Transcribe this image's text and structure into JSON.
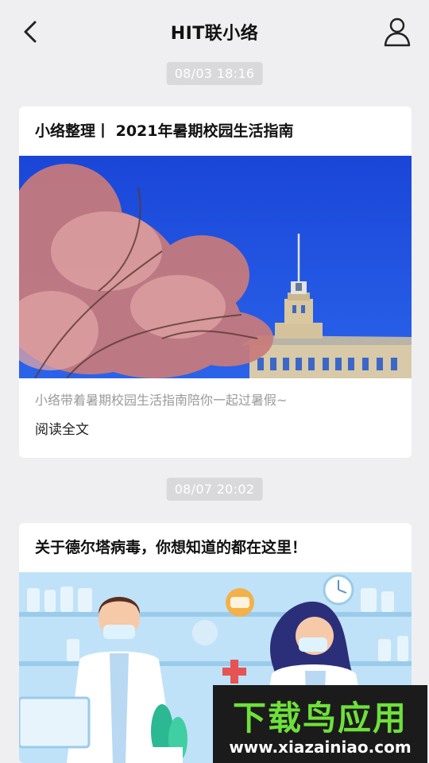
{
  "header": {
    "title": "HIT联小络"
  },
  "messages": [
    {
      "time": "08/03 18:16",
      "title": "小络整理丨 2021年暑期校园生活指南",
      "desc": "小络带着暑期校园生活指南陪你一起过暑假~",
      "read_more": "阅读全文",
      "image": "campus-building-with-blossoms"
    },
    {
      "time": "08/07 20:02",
      "title": "关于德尔塔病毒，你想知道的都在这里！",
      "image": "doctors-illustration"
    }
  ],
  "watermark": {
    "main": "下载鸟应用",
    "url": "www.xiazainiao.com"
  },
  "colors": {
    "background": "#efeff1",
    "sky": "#1f4fdc",
    "blossom": "#d98a8a",
    "accent_green": "#6fe03b"
  }
}
